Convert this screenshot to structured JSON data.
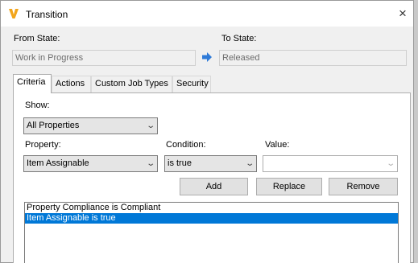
{
  "window": {
    "title": "Transition",
    "close_glyph": "×",
    "icon": "vault-v-icon"
  },
  "states": {
    "from_label": "From State:",
    "from_value": "Work in Progress",
    "to_label": "To State:",
    "to_value": "Released"
  },
  "tabs": [
    {
      "label": "Criteria",
      "active": true
    },
    {
      "label": "Actions",
      "active": false
    },
    {
      "label": "Custom Job Types",
      "active": false
    },
    {
      "label": "Security",
      "active": false
    }
  ],
  "criteria": {
    "show_label": "Show:",
    "show_value": "All Properties",
    "property_label": "Property:",
    "property_value": "Item Assignable",
    "condition_label": "Condition:",
    "condition_value": "is true",
    "value_label": "Value:",
    "value_value": "",
    "buttons": {
      "add": "Add",
      "replace": "Replace",
      "remove": "Remove"
    },
    "list": [
      {
        "text": "Property Compliance is Compliant",
        "selected": false
      },
      {
        "text": "Item Assignable is true",
        "selected": true
      }
    ]
  },
  "colors": {
    "selection": "#0078d7",
    "icon_orange": "#f2a51c",
    "arrow_blue": "#2f7bd8"
  }
}
